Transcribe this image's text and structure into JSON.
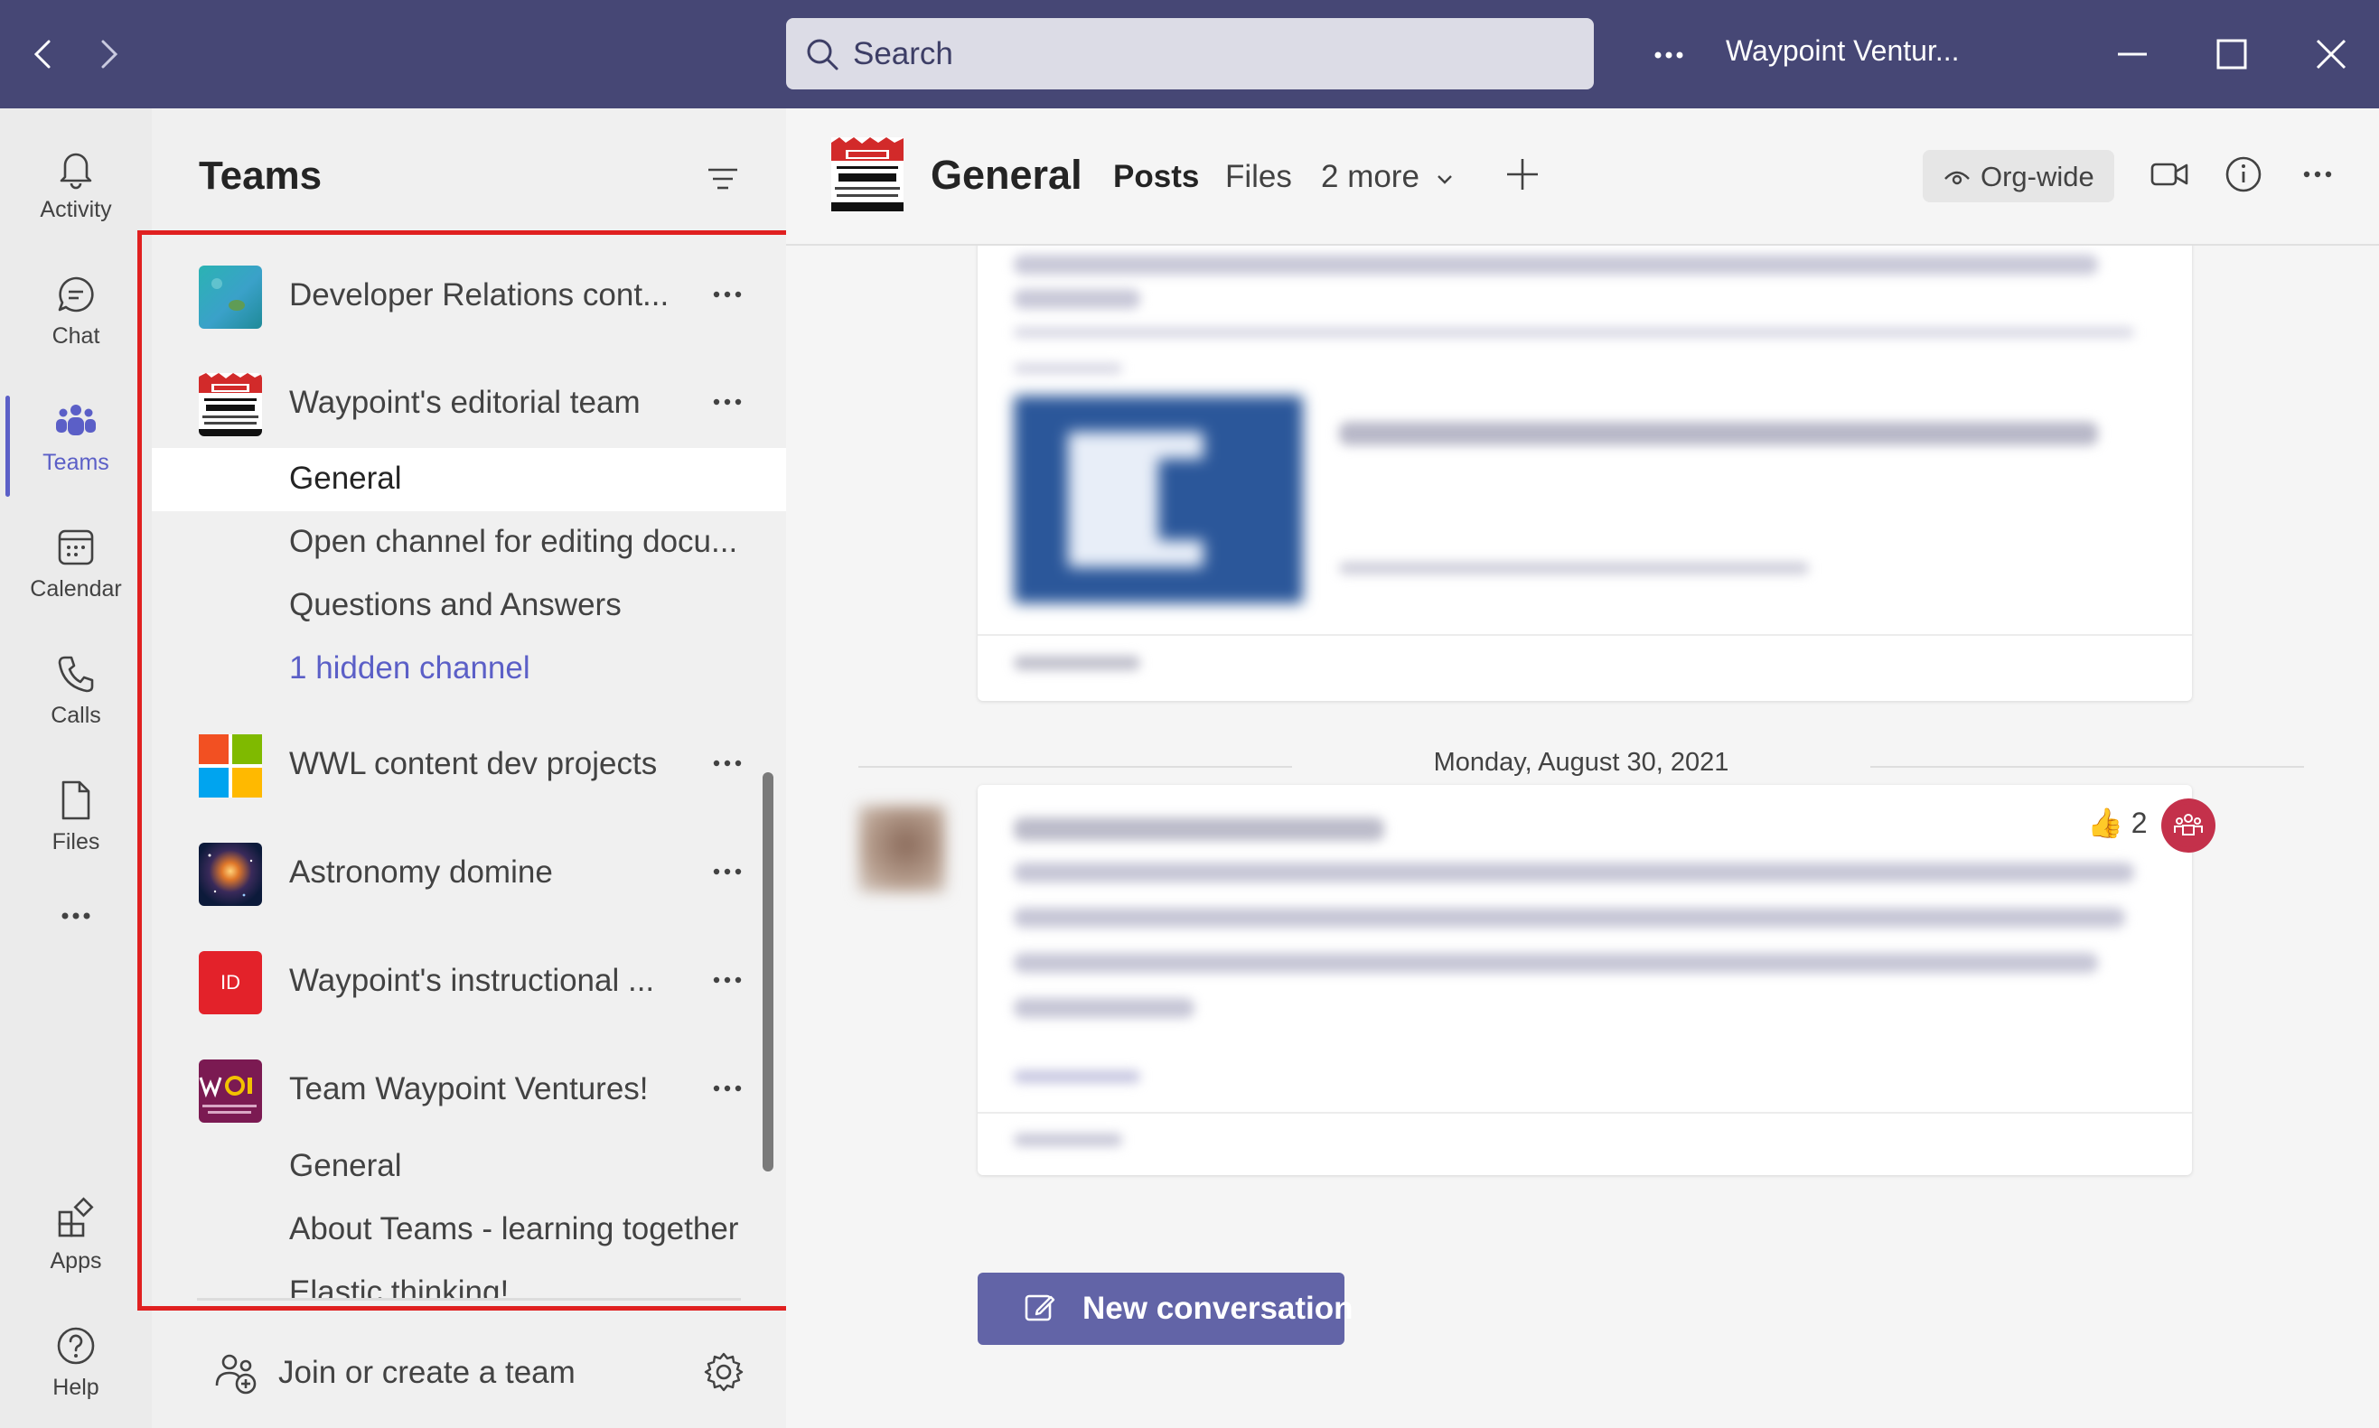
{
  "titlebar": {
    "search_placeholder": "Search",
    "org_name": "Waypoint Ventur..."
  },
  "appbar": {
    "items": [
      {
        "label": "Activity",
        "icon": "bell-icon"
      },
      {
        "label": "Chat",
        "icon": "chat-icon"
      },
      {
        "label": "Teams",
        "icon": "teams-icon",
        "active": true
      },
      {
        "label": "Calendar",
        "icon": "calendar-icon"
      },
      {
        "label": "Calls",
        "icon": "phone-icon"
      },
      {
        "label": "Files",
        "icon": "file-icon"
      },
      {
        "label": "Apps",
        "icon": "apps-icon"
      },
      {
        "label": "Help",
        "icon": "help-icon"
      }
    ]
  },
  "teams_panel": {
    "title": "Teams",
    "teams": [
      {
        "name": "Developer Relations cont...",
        "icon": "teal-underwater-image"
      },
      {
        "name": "Waypoint's editorial team",
        "icon": "editing-logo"
      },
      {
        "name": "WWL content dev projects",
        "icon": "microsoft-logo"
      },
      {
        "name": "Astronomy domine",
        "icon": "galaxy-image"
      },
      {
        "name": "Waypoint's instructional ...",
        "icon": "id-badge",
        "badge_text": "ID"
      },
      {
        "name": "Team Waypoint Ventures!",
        "icon": "waypoint-logo"
      }
    ],
    "editorial_channels": [
      {
        "name": "General",
        "selected": true
      },
      {
        "name": "Open channel for editing docu..."
      },
      {
        "name": "Questions and Answers"
      },
      {
        "name": "1 hidden channel",
        "link": true
      }
    ],
    "ventures_channels": [
      {
        "name": "General"
      },
      {
        "name": "About Teams - learning together"
      },
      {
        "name": "Elastic thinking!"
      }
    ],
    "join_label": "Join or create a team"
  },
  "channel_header": {
    "title": "General",
    "tabs": [
      "Posts",
      "Files",
      "2 more"
    ],
    "orgwide_label": "Org-wide"
  },
  "feed": {
    "date_divider": "Monday, August 30, 2021",
    "reaction_count": "2",
    "new_conversation_label": "New conversation"
  },
  "colors": {
    "titlebar": "#464775",
    "accent": "#5b5fc7",
    "button": "#6264a7",
    "highlight": "#e02020"
  }
}
